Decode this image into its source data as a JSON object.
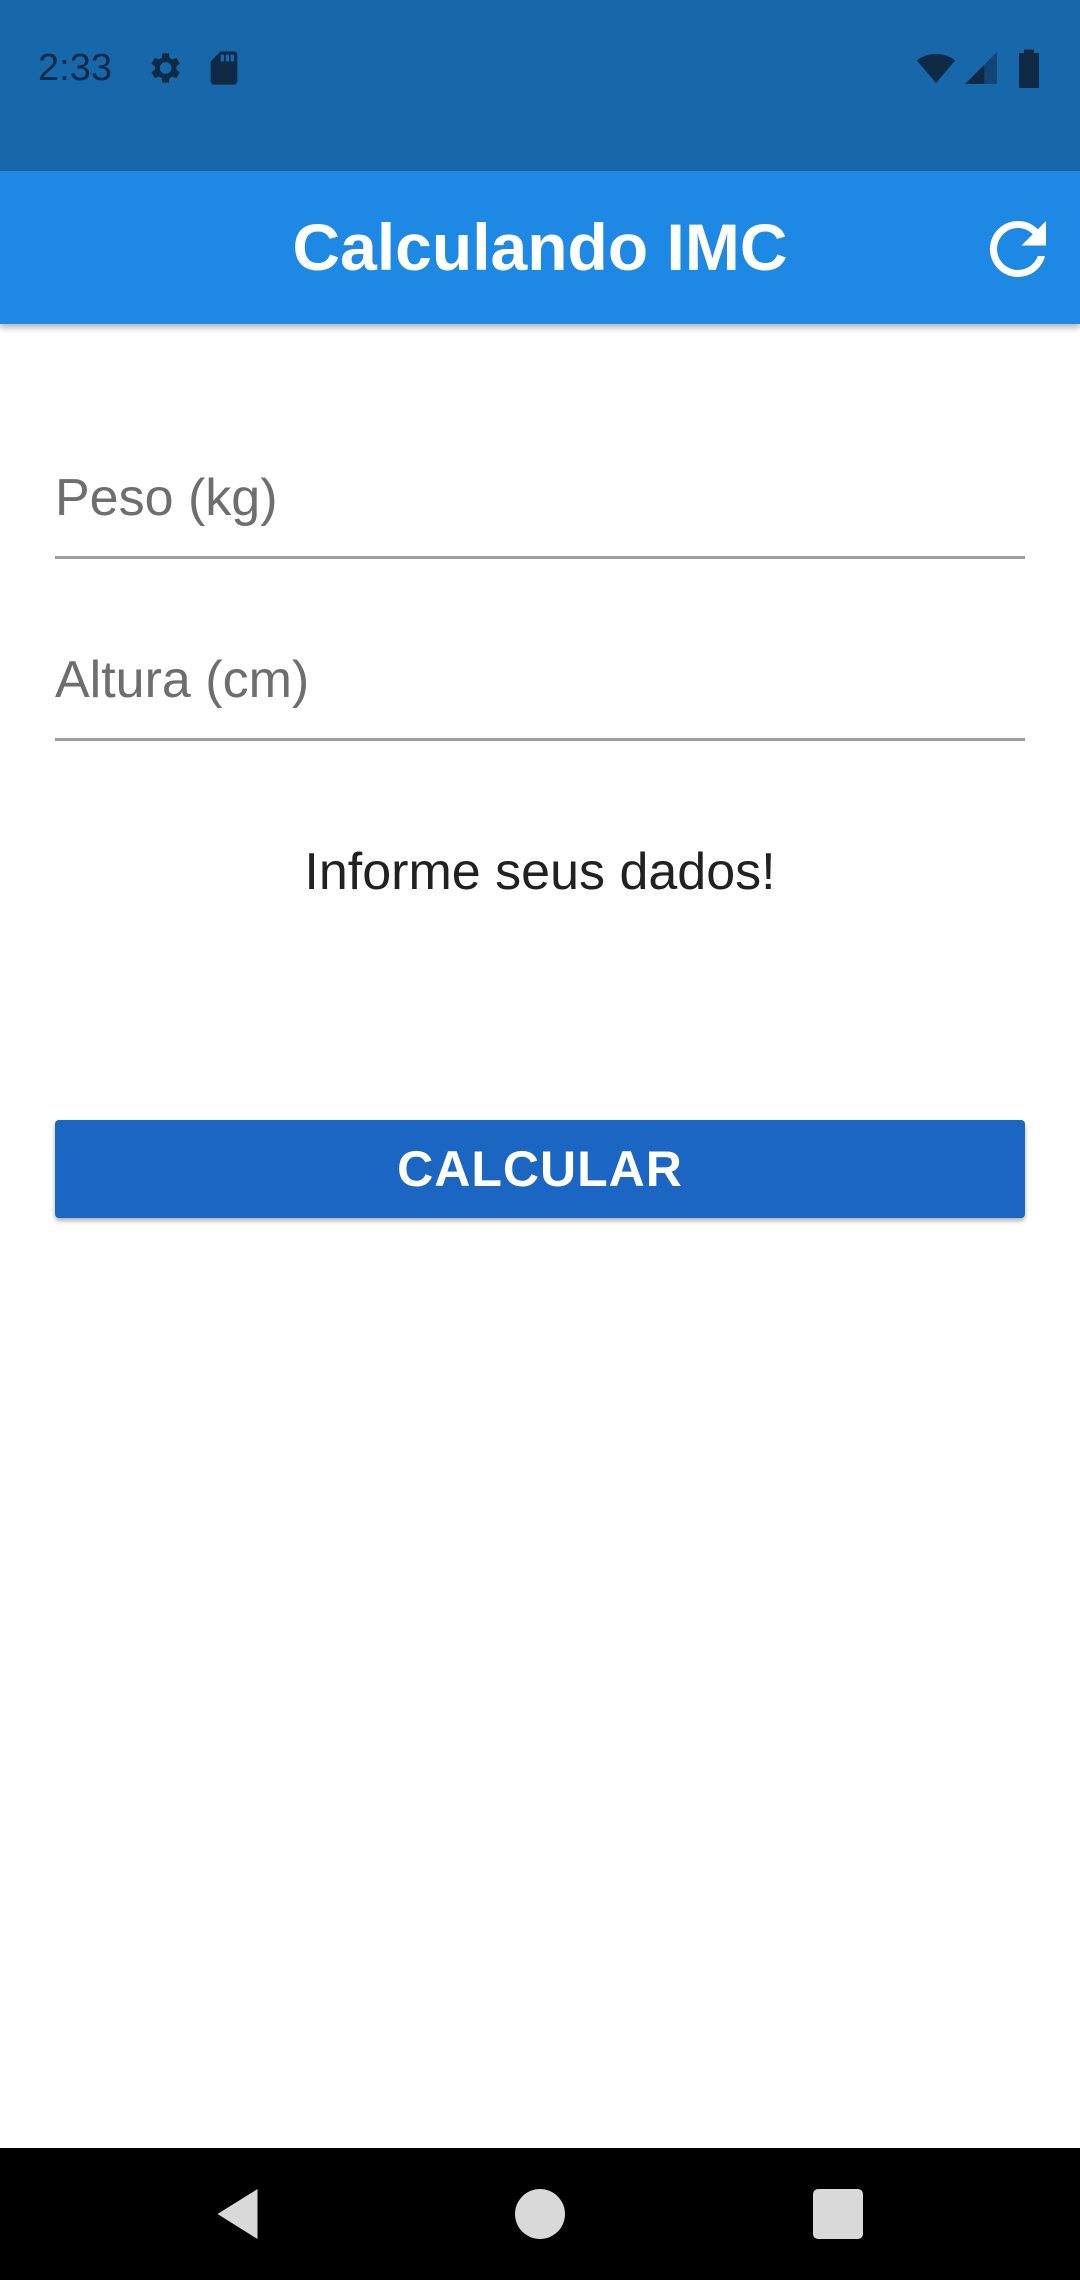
{
  "status_bar": {
    "time": "2:33",
    "icons": [
      "gear-icon",
      "sd-card-icon",
      "wifi-icon",
      "signal-icon",
      "battery-icon"
    ],
    "background": "#1767ab"
  },
  "app_bar": {
    "title": "Calculando IMC",
    "action_icon": "refresh-icon",
    "background": "#1e88e5"
  },
  "form": {
    "weight_placeholder": "Peso (kg)",
    "weight_value": "",
    "height_placeholder": "Altura (cm)",
    "height_value": ""
  },
  "info_text": "Informe seus dados!",
  "calculate_button": {
    "label": "CALCULAR",
    "color": "#1a66c2"
  },
  "nav_bar": {
    "buttons": [
      "back-icon",
      "home-icon",
      "recents-icon"
    ]
  }
}
